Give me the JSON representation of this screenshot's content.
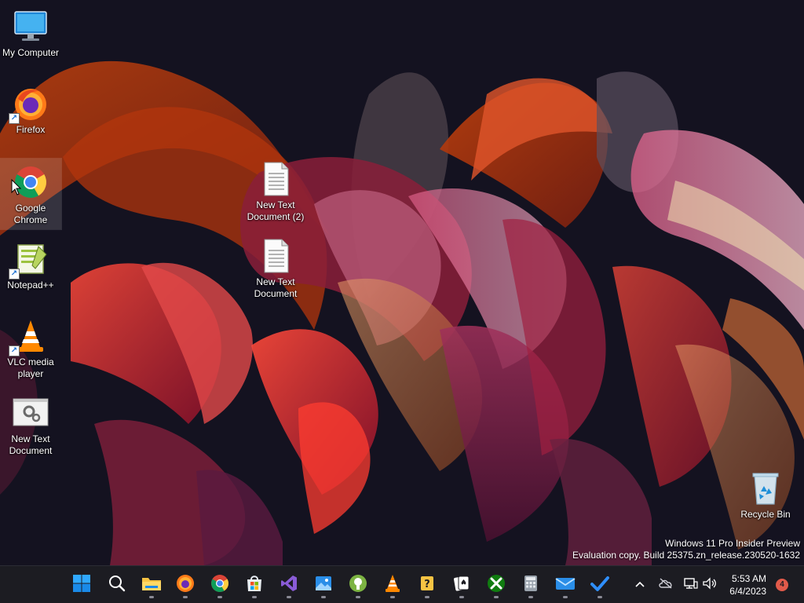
{
  "desktop": {
    "icons": [
      {
        "label": "My Computer"
      },
      {
        "label": "Firefox"
      },
      {
        "label": "Google Chrome"
      },
      {
        "label": "Notepad++"
      },
      {
        "label": "VLC media player"
      },
      {
        "label": "New Text Document"
      },
      {
        "label": "New Text Document (2)"
      },
      {
        "label": "New Text Document"
      },
      {
        "label": "Recycle Bin"
      }
    ],
    "watermark": {
      "line1": "Windows 11 Pro Insider Preview",
      "line2": "Evaluation copy. Build 25375.zn_release.230520-1632"
    }
  },
  "taskbar": {
    "apps": [
      {
        "icon": "windows-start-icon",
        "running": false
      },
      {
        "icon": "search-icon",
        "running": false
      },
      {
        "icon": "file-explorer-icon",
        "running": true
      },
      {
        "icon": "firefox-icon",
        "running": true
      },
      {
        "icon": "chrome-icon",
        "running": true
      },
      {
        "icon": "microsoft-store-icon",
        "running": true
      },
      {
        "icon": "visual-studio-icon",
        "running": true
      },
      {
        "icon": "photos-icon",
        "running": true
      },
      {
        "icon": "tips-icon",
        "running": true
      },
      {
        "icon": "vlc-icon",
        "running": true
      },
      {
        "icon": "help-icon",
        "running": true
      },
      {
        "icon": "solitaire-icon",
        "running": true
      },
      {
        "icon": "xbox-icon",
        "running": true
      },
      {
        "icon": "calculator-icon",
        "running": true
      },
      {
        "icon": "mail-icon",
        "running": true
      },
      {
        "icon": "todo-icon",
        "running": true
      }
    ],
    "tray": {
      "time": "5:53 AM",
      "date": "6/4/2023",
      "notification_count": "4"
    }
  },
  "colors": {
    "taskbar_bg": "#1c1c22",
    "wallpaper_bg": "#141220",
    "accent": "#0a7cd8",
    "notification_badge": "#e15a4a"
  }
}
